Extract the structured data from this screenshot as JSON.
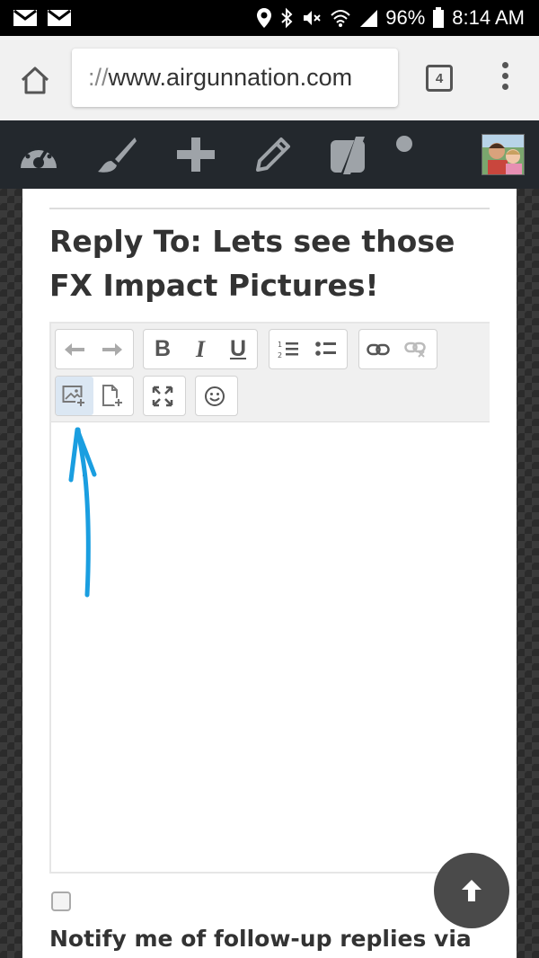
{
  "status_bar": {
    "battery": "96%",
    "time": "8:14 AM",
    "icons": [
      "gmail-icon",
      "gmail-icon",
      "location-icon",
      "bluetooth-icon",
      "mute-icon",
      "wifi-icon",
      "signal-icon",
      "battery-icon"
    ]
  },
  "browser": {
    "url_scheme": "://",
    "url_host": "www.airgunnation.com",
    "tab_count": "4"
  },
  "admin_bar": {
    "icons": [
      "dashboard-icon",
      "customize-brush-icon",
      "new-plus-icon",
      "edit-pencil-icon",
      "yoast-icon",
      "status-dot-icon",
      "avatar"
    ]
  },
  "reply": {
    "title": "Reply To: Lets see those FX Impact Pictures!"
  },
  "toolbar": {
    "undo": "undo-icon",
    "redo": "redo-icon",
    "bold": "B",
    "italic": "I",
    "underline": "U",
    "ordered_list": "ordered-list-icon",
    "bullet_list": "bullet-list-icon",
    "link": "link-icon",
    "unlink": "unlink-icon",
    "insert_image": "insert-image-icon",
    "insert_file": "insert-file-icon",
    "fullscreen": "fullscreen-icon",
    "emoji": "emoji-icon"
  },
  "notify": {
    "label": "Notify me of follow-up replies via"
  },
  "colors": {
    "annotation_arrow": "#1a9ee0",
    "admin_bar": "#23282d"
  }
}
